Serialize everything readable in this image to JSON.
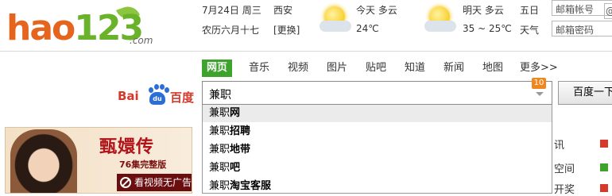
{
  "logo": {
    "main": "hao",
    "num": "123",
    "suffix": ".com"
  },
  "weather": {
    "date": "7月24日 周三",
    "lunar": "农历六月十七",
    "city": "西安",
    "change": "[更换]",
    "today_label": "今天 多云",
    "today_temp": "24℃",
    "tomorrow_label": "明天 多云",
    "tomorrow_temp": "35 ~ 25℃",
    "day5_label": "五日",
    "day5_sub": "天气"
  },
  "mail": {
    "account_placeholder": "邮箱帐号",
    "password_placeholder": "邮箱密码",
    "at": "@"
  },
  "tabs": [
    "网页",
    "音乐",
    "视频",
    "图片",
    "贴吧",
    "知道",
    "新闻",
    "地图",
    "更多>>"
  ],
  "baidu": {
    "bai": "Bai",
    "du": "du",
    "cn": "百度"
  },
  "search": {
    "value": "兼职",
    "badge": "10",
    "button": "百度一下"
  },
  "suggestions": [
    {
      "prefix": "兼职",
      "suffix": "网"
    },
    {
      "prefix": "兼职",
      "suffix": "招聘"
    },
    {
      "prefix": "兼职",
      "suffix": "地带"
    },
    {
      "prefix": "兼职",
      "suffix": "吧"
    },
    {
      "prefix": "兼职",
      "suffix": "淘宝客服"
    }
  ],
  "banner": {
    "title": "甄嬛传",
    "sub": "76集完整版",
    "bar": "看视频无广告"
  },
  "right_fragments": [
    "讯",
    "空间",
    "开奖"
  ],
  "colors": {
    "brand_orange": "#e5641e",
    "brand_green": "#6ab22a",
    "tab_active": "#3da32c",
    "baidu_red": "#d6382a",
    "baidu_blue": "#2b6ed8",
    "badge": "#f0861e"
  }
}
